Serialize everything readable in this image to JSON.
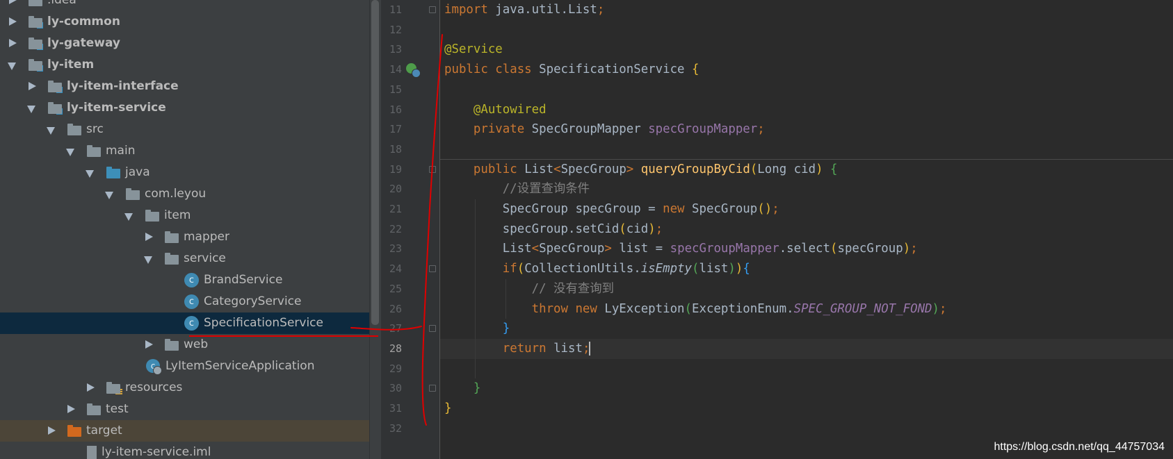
{
  "project_tree": {
    "items": [
      {
        "label": ".idea",
        "kind": "folder",
        "state": "collapsed"
      },
      {
        "label": "ly-common",
        "kind": "module",
        "state": "collapsed"
      },
      {
        "label": "ly-gateway",
        "kind": "module",
        "state": "collapsed"
      },
      {
        "label": "ly-item",
        "kind": "module",
        "state": "expanded"
      },
      {
        "label": "ly-item-interface",
        "kind": "module",
        "state": "collapsed"
      },
      {
        "label": "ly-item-service",
        "kind": "module",
        "state": "expanded"
      },
      {
        "label": "src",
        "kind": "folder",
        "state": "expanded"
      },
      {
        "label": "main",
        "kind": "folder",
        "state": "expanded"
      },
      {
        "label": "java",
        "kind": "source-root",
        "state": "expanded"
      },
      {
        "label": "com.leyou",
        "kind": "package",
        "state": "expanded"
      },
      {
        "label": "item",
        "kind": "package",
        "state": "expanded"
      },
      {
        "label": "mapper",
        "kind": "package",
        "state": "collapsed"
      },
      {
        "label": "service",
        "kind": "package",
        "state": "expanded"
      },
      {
        "label": "BrandService",
        "kind": "class"
      },
      {
        "label": "CategoryService",
        "kind": "class"
      },
      {
        "label": "SpecificationService",
        "kind": "class",
        "selected": true
      },
      {
        "label": "web",
        "kind": "package",
        "state": "collapsed"
      },
      {
        "label": "LyItemServiceApplication",
        "kind": "spring-app"
      },
      {
        "label": "resources",
        "kind": "resources-root",
        "state": "collapsed"
      },
      {
        "label": "test",
        "kind": "folder",
        "state": "collapsed"
      },
      {
        "label": "target",
        "kind": "excluded-folder",
        "state": "collapsed"
      },
      {
        "label": "ly-item-service.iml",
        "kind": "iml-file"
      }
    ]
  },
  "editor": {
    "line_numbers": [
      "11",
      "12",
      "13",
      "14",
      "15",
      "16",
      "17",
      "18",
      "19",
      "20",
      "21",
      "22",
      "23",
      "24",
      "25",
      "26",
      "27",
      "28",
      "29",
      "30",
      "31",
      "32"
    ],
    "current_line": "28",
    "lines": [
      [
        {
          "t": "import ",
          "c": "kw"
        },
        {
          "t": "java.util.List"
        },
        {
          "t": ";",
          "c": "kw"
        }
      ],
      [],
      [
        {
          "t": "@Service",
          "c": "ann"
        }
      ],
      [
        {
          "t": "public class ",
          "c": "kw"
        },
        {
          "t": "SpecificationService "
        },
        {
          "t": "{",
          "c": "bY"
        }
      ],
      [],
      [
        {
          "t": "    "
        },
        {
          "t": "@Autowired",
          "c": "ann"
        }
      ],
      [
        {
          "t": "    "
        },
        {
          "t": "private ",
          "c": "kw"
        },
        {
          "t": "SpecGroupMapper "
        },
        {
          "t": "specGroupMapper",
          "c": "fld"
        },
        {
          "t": ";",
          "c": "kw"
        }
      ],
      [],
      [
        {
          "t": "    "
        },
        {
          "t": "public ",
          "c": "kw"
        },
        {
          "t": "List"
        },
        {
          "t": "<",
          "c": "kw"
        },
        {
          "t": "SpecGroup"
        },
        {
          "t": "> ",
          "c": "kw"
        },
        {
          "t": "queryGroupByCid",
          "c": "mth"
        },
        {
          "t": "(",
          "c": "bY"
        },
        {
          "t": "Long cid"
        },
        {
          "t": ") ",
          "c": "bY"
        },
        {
          "t": "{",
          "c": "bG"
        }
      ],
      [
        {
          "t": "        "
        },
        {
          "t": "//设置查询条件",
          "c": "cmt"
        }
      ],
      [
        {
          "t": "        "
        },
        {
          "t": "SpecGroup specGroup = "
        },
        {
          "t": "new ",
          "c": "kw"
        },
        {
          "t": "SpecGroup"
        },
        {
          "t": "()",
          "c": "bY"
        },
        {
          "t": ";",
          "c": "kw"
        }
      ],
      [
        {
          "t": "        "
        },
        {
          "t": "specGroup.setCid"
        },
        {
          "t": "(",
          "c": "bY"
        },
        {
          "t": "cid"
        },
        {
          "t": ")",
          "c": "bY"
        },
        {
          "t": ";",
          "c": "kw"
        }
      ],
      [
        {
          "t": "        "
        },
        {
          "t": "List"
        },
        {
          "t": "<",
          "c": "kw"
        },
        {
          "t": "SpecGroup"
        },
        {
          "t": "> ",
          "c": "kw"
        },
        {
          "t": "list = "
        },
        {
          "t": "specGroupMapper",
          "c": "fld"
        },
        {
          "t": ".select"
        },
        {
          "t": "(",
          "c": "bY"
        },
        {
          "t": "specGroup"
        },
        {
          "t": ")",
          "c": "bY"
        },
        {
          "t": ";",
          "c": "kw"
        }
      ],
      [
        {
          "t": "        "
        },
        {
          "t": "if",
          "c": "kw"
        },
        {
          "t": "(",
          "c": "bY"
        },
        {
          "t": "CollectionUtils."
        },
        {
          "t": "isEmpty",
          "c": "ital"
        },
        {
          "t": "(",
          "c": "bG"
        },
        {
          "t": "list"
        },
        {
          "t": ")",
          "c": "bG"
        },
        {
          "t": ")",
          "c": "bY"
        },
        {
          "t": "{",
          "c": "bB"
        }
      ],
      [
        {
          "t": "            "
        },
        {
          "t": "// 没有查询到",
          "c": "cmt"
        }
      ],
      [
        {
          "t": "            "
        },
        {
          "t": "throw new ",
          "c": "kw"
        },
        {
          "t": "LyException"
        },
        {
          "t": "(",
          "c": "bG"
        },
        {
          "t": "ExceptionEnum."
        },
        {
          "t": "SPEC_GROUP_NOT_FOND",
          "c": "sfld"
        },
        {
          "t": ")",
          "c": "bG"
        },
        {
          "t": ";",
          "c": "kw"
        }
      ],
      [
        {
          "t": "        "
        },
        {
          "t": "}",
          "c": "bB"
        }
      ],
      [
        {
          "t": "        "
        },
        {
          "t": "return ",
          "c": "kw"
        },
        {
          "t": "list"
        },
        {
          "t": ";",
          "c": "kw"
        }
      ],
      [],
      [
        {
          "t": "    "
        },
        {
          "t": "}",
          "c": "bG"
        }
      ],
      [
        {
          "t": "}",
          "c": "bY"
        }
      ],
      []
    ]
  },
  "watermark": "https://blog.csdn.net/qq_44757034",
  "colors": {
    "tree_bg": "#3c3f41",
    "editor_bg": "#2b2b2b",
    "gutter_bg": "#313335",
    "selection_bg": "#0d293e",
    "annotation_red": "#e00000"
  }
}
